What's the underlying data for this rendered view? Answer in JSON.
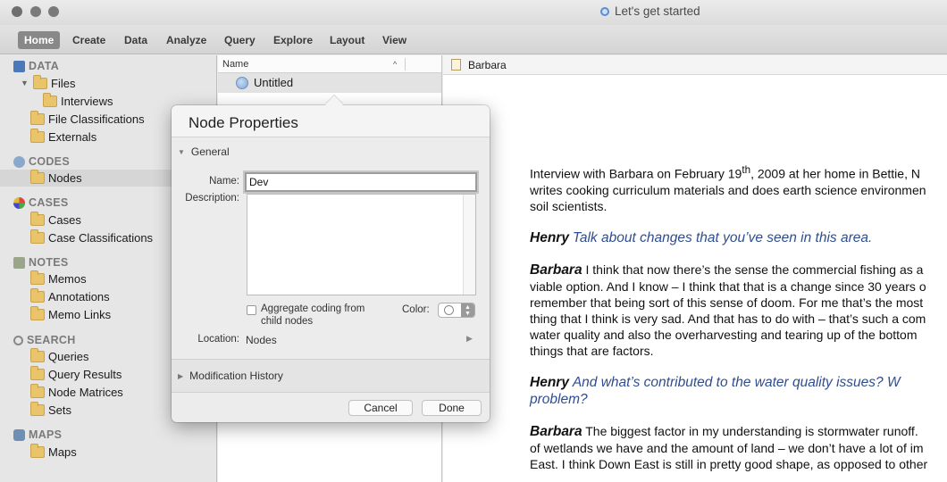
{
  "window": {
    "title": "Let's get started"
  },
  "ribbon": {
    "tabs": [
      "Home",
      "Create",
      "Data",
      "Analyze",
      "Query",
      "Explore",
      "Layout",
      "View"
    ],
    "active": "Home"
  },
  "nav": {
    "data": {
      "section": "DATA",
      "files": "Files",
      "interviews": "Interviews",
      "file_classifications": "File Classifications",
      "externals": "Externals"
    },
    "codes": {
      "section": "CODES",
      "nodes": "Nodes"
    },
    "cases": {
      "section": "CASES",
      "cases": "Cases",
      "case_classifications": "Case Classifications"
    },
    "notes": {
      "section": "NOTES",
      "memos": "Memos",
      "annotations": "Annotations",
      "memo_links": "Memo Links"
    },
    "search": {
      "section": "SEARCH",
      "queries": "Queries",
      "query_results": "Query Results",
      "node_matrices": "Node Matrices",
      "sets": "Sets"
    },
    "maps": {
      "section": "MAPS",
      "maps": "Maps"
    }
  },
  "list": {
    "column_header": "Name",
    "rows": [
      "Untitled"
    ]
  },
  "document": {
    "title": "Barbara",
    "p1a": "Interview with Barbara on February 19",
    "p1sup": "th",
    "p1b": ", 2009 at her home in Bettie, N",
    "p1c": "writes cooking curriculum materials and does earth science environmen",
    "p1d": "soil scientists.",
    "q1_speaker": "Henry",
    "q1_text": "Talk about changes that you’ve seen in this area.",
    "a1_speaker": "Barbara",
    "a1_lines": [
      "I think that now there’s the sense the commercial fishing as a",
      "viable option. And I know – I think that that is a change since 30 years o",
      "remember that being sort of this sense of doom. For me that’s the most",
      "thing that I think is very sad. And that has to do with – that’s such a com",
      "water quality and also the overharvesting and tearing up of the bottom",
      "things that are factors."
    ],
    "q2_speaker": "Henry",
    "q2_line1": "And what’s contributed to the water quality issues? W",
    "q2_line2": "problem?",
    "a2_speaker": "Barbara",
    "a2_lines": [
      "The biggest factor in my understanding is stormwater runoff.",
      "of wetlands we have and the amount of land – we don’t have a lot of im",
      "East. I think Down East is still in pretty good shape, as opposed to other"
    ]
  },
  "dialog": {
    "title": "Node Properties",
    "general": "General",
    "name_label": "Name:",
    "name_value": "Dev",
    "description_label": "Description:",
    "aggregate_label": "Aggregate coding from child nodes",
    "color_label": "Color:",
    "location_label": "Location:",
    "location_value": "Nodes",
    "modification_history": "Modification History",
    "cancel": "Cancel",
    "done": "Done"
  }
}
